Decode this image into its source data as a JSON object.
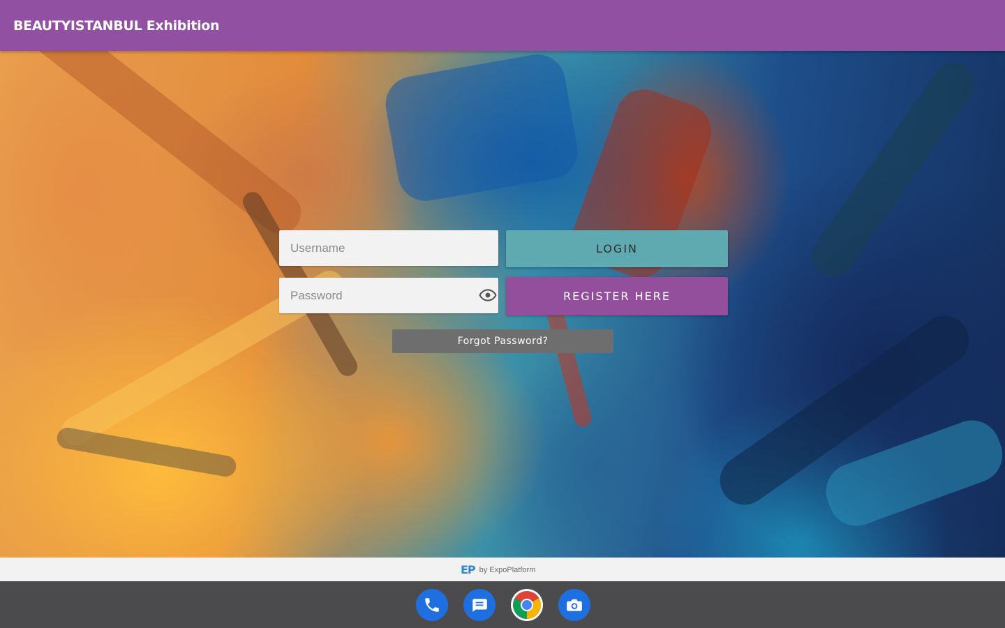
{
  "app_bar": {
    "title": "BEAUTYISTANBUL Exhibition",
    "color": "#9150a2"
  },
  "login": {
    "username_placeholder": "Username",
    "password_placeholder": "Password",
    "password_toggle_icon": "eye-icon",
    "login_label": "LOGIN",
    "register_label": "REGISTER HERE",
    "forgot_label": "Forgot Password?",
    "login_color": "#5fa9b0",
    "register_color": "#944f9c",
    "forgot_color": "#6e6e6e"
  },
  "footer": {
    "logo_text": "EP",
    "powered_by": "by ExpoPlatform"
  },
  "dock": {
    "apps": [
      {
        "name": "Phone",
        "icon": "phone-icon"
      },
      {
        "name": "Messages",
        "icon": "messages-icon"
      },
      {
        "name": "Chrome",
        "icon": "chrome-icon"
      },
      {
        "name": "Camera",
        "icon": "camera-icon"
      }
    ]
  }
}
